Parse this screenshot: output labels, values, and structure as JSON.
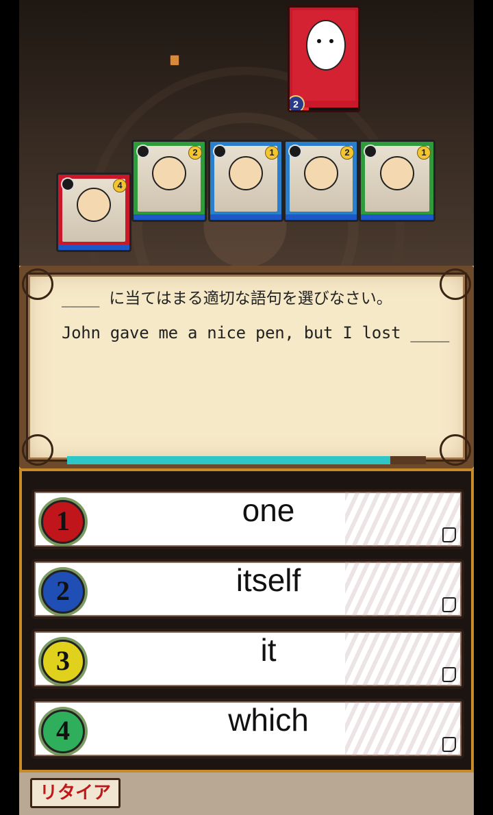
{
  "battle": {
    "enemy": {
      "level": "2",
      "hp_fraction": 0.1,
      "color": "#c8182a"
    },
    "party": [
      {
        "cost": "4",
        "color": "#c8182a"
      },
      {
        "cost": "2",
        "color": "#2e9c3a"
      },
      {
        "cost": "1",
        "color": "#2a7fcc"
      },
      {
        "cost": "2",
        "color": "#2a7fcc"
      },
      {
        "cost": "1",
        "color": "#2e9c3a"
      }
    ]
  },
  "question": {
    "instruction": "____ に当てはまる適切な語句を選びなさい。",
    "sentence": "John gave me a nice pen, but I lost ____",
    "timer_fraction": 0.9
  },
  "answers": [
    {
      "number": "1",
      "text": "one",
      "badge_color": "#c0151b"
    },
    {
      "number": "2",
      "text": "itself",
      "badge_color": "#1f4fb5"
    },
    {
      "number": "3",
      "text": "it",
      "badge_color": "#e0d21c"
    },
    {
      "number": "4",
      "text": "which",
      "badge_color": "#2fae5c"
    }
  ],
  "footer": {
    "retire_label": "リタイア"
  }
}
